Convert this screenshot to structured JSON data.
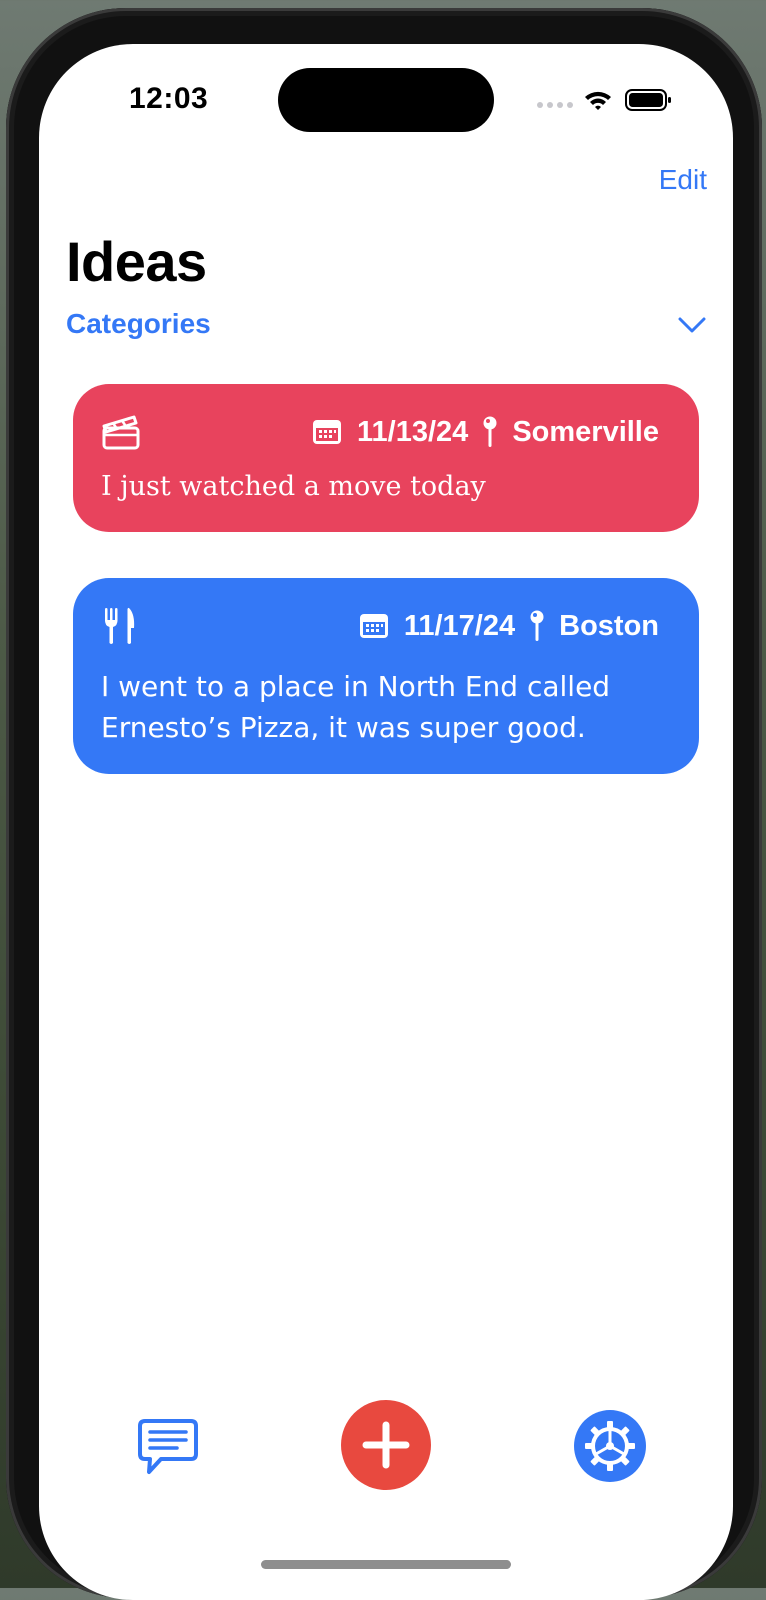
{
  "status_bar": {
    "time": "12:03"
  },
  "nav": {
    "edit_label": "Edit"
  },
  "page": {
    "title": "Ideas",
    "categories_label": "Categories"
  },
  "ideas": [
    {
      "category_icon": "clapperboard-icon",
      "date": "11/13/24",
      "location": "Somerville",
      "text": "I just watched a move today",
      "color": "#e8435d"
    },
    {
      "category_icon": "fork-knife-icon",
      "date": "11/17/24",
      "location": "Boston",
      "text": "I went to a place in North End called Ernesto’s Pizza, it was super good.",
      "color": "#3478f6"
    }
  ],
  "tab_bar": {
    "left_icon": "message-bubble-icon",
    "center_icon": "plus-icon",
    "right_icon": "gear-icon"
  },
  "colors": {
    "accent": "#3478f6",
    "add": "#e8493f",
    "card_red": "#e8435d",
    "card_blue": "#3478f6"
  }
}
